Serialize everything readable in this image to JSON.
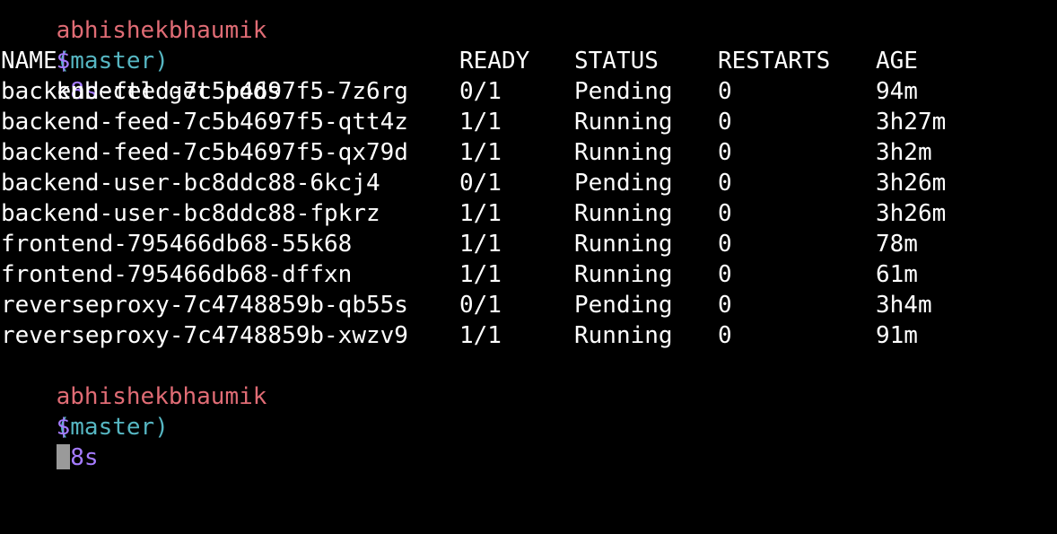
{
  "colors": {
    "background": "#000000",
    "foreground": "#ffffff",
    "user": "#e06c75",
    "branch": "#56b6c2",
    "directory": "#a57bff",
    "dollar": "#a57bff",
    "cursor": "#9a9a9a"
  },
  "prompt_top": {
    "user": "abhishekbhaumik",
    "branch": "(master)",
    "dir": "k8s"
  },
  "command_line": {
    "dollar": "$",
    "command": "kubectl get pods"
  },
  "table": {
    "headers": [
      "NAME",
      "READY",
      "STATUS",
      "RESTARTS",
      "AGE"
    ],
    "rows": [
      [
        "backend-feed-7c5b4697f5-7z6rg",
        "0/1",
        "Pending",
        "0",
        "94m"
      ],
      [
        "backend-feed-7c5b4697f5-qtt4z",
        "1/1",
        "Running",
        "0",
        "3h27m"
      ],
      [
        "backend-feed-7c5b4697f5-qx79d",
        "1/1",
        "Running",
        "0",
        "3h2m"
      ],
      [
        "backend-user-bc8ddc88-6kcj4",
        "0/1",
        "Pending",
        "0",
        "3h26m"
      ],
      [
        "backend-user-bc8ddc88-fpkrz",
        "1/1",
        "Running",
        "0",
        "3h26m"
      ],
      [
        "frontend-795466db68-55k68",
        "1/1",
        "Running",
        "0",
        "78m"
      ],
      [
        "frontend-795466db68-dffxn",
        "1/1",
        "Running",
        "0",
        "61m"
      ],
      [
        "reverseproxy-7c4748859b-qb55s",
        "0/1",
        "Pending",
        "0",
        "3h4m"
      ],
      [
        "reverseproxy-7c4748859b-xwzv9",
        "1/1",
        "Running",
        "0",
        "91m"
      ]
    ]
  },
  "prompt_bottom": {
    "user": "abhishekbhaumik",
    "branch": "(master)",
    "dir": "k8s"
  },
  "input_line": {
    "dollar": "$"
  }
}
